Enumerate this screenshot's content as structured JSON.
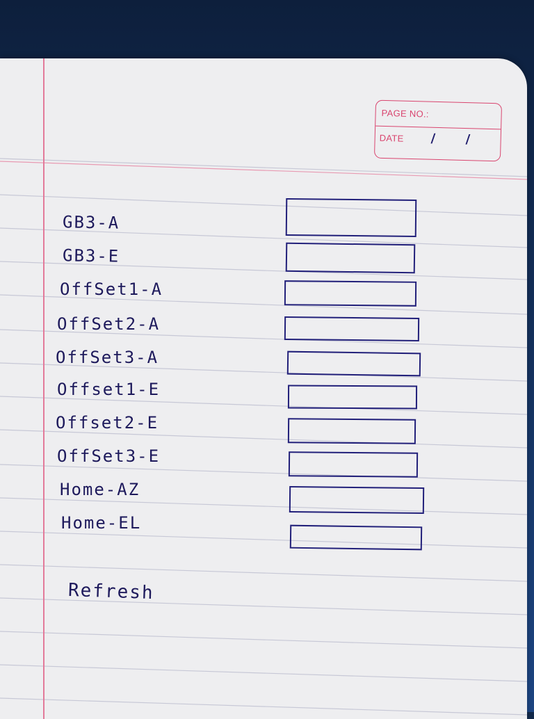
{
  "header_box": {
    "page_no_label": "PAGE NO.:",
    "date_label": "DATE",
    "date_value": "/ /"
  },
  "fields": [
    {
      "label": "GB3-A"
    },
    {
      "label": "GB3-E"
    },
    {
      "label": "OffSet1-A"
    },
    {
      "label": "OffSet2-A"
    },
    {
      "label": "OffSet3-A"
    },
    {
      "label": "Offset1-E"
    },
    {
      "label": "Offset2-E"
    },
    {
      "label": "OffSet3-E"
    },
    {
      "label": "Home-AZ"
    },
    {
      "label": "Home-EL"
    }
  ],
  "refresh_label": "Refresh",
  "colors": {
    "ink": "#1e1a5c",
    "stamp_pink": "#d9456f",
    "margin_red": "#e37a9a",
    "paper": "#eeeef0"
  }
}
